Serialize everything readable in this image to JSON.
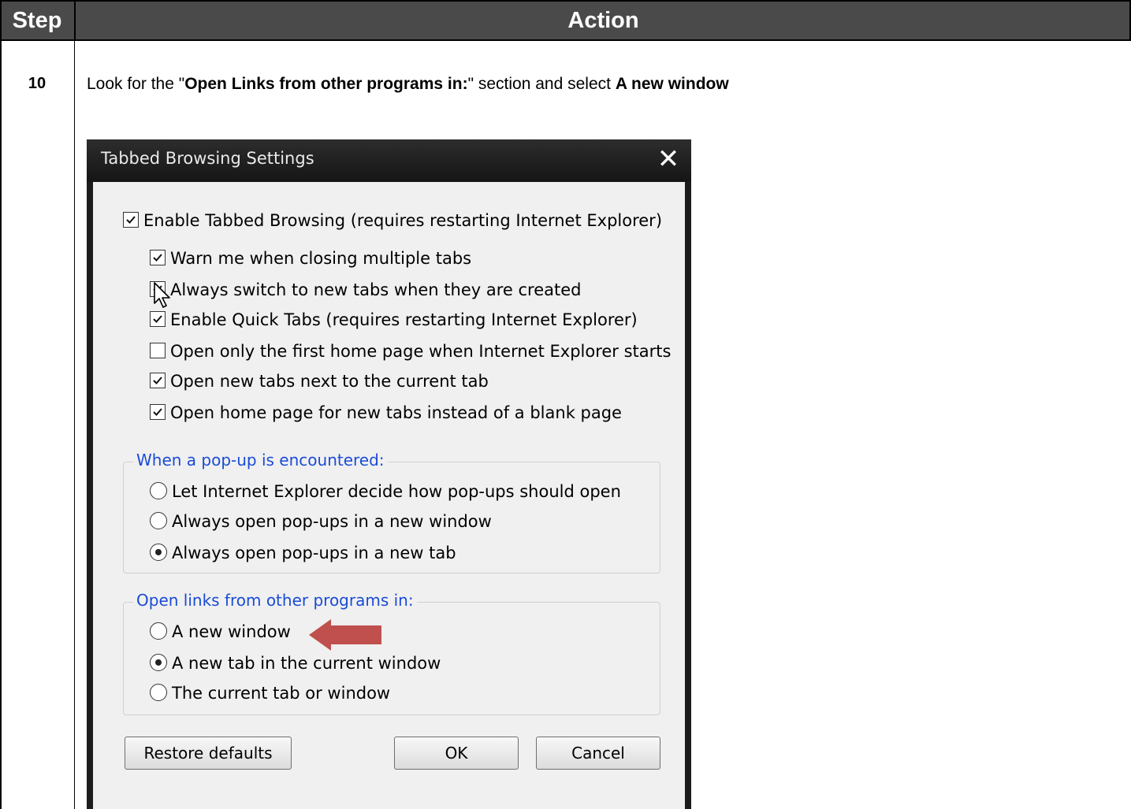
{
  "table": {
    "header_step": "Step",
    "header_action": "Action",
    "step_number": "10",
    "instruction": {
      "part1": "Look for the \"",
      "bold1": "Open Links from other programs in:",
      "part2": "\"  section and select ",
      "bold2": "A new window"
    }
  },
  "dialog": {
    "title": "Tabbed Browsing Settings",
    "close_glyph": "✕",
    "checkboxes": [
      {
        "label": "Enable Tabbed Browsing (requires restarting Internet Explorer)",
        "checked": true
      },
      {
        "label": "Warn me when closing multiple tabs",
        "checked": true
      },
      {
        "label": "Always switch to new tabs when they are created",
        "checked": true
      },
      {
        "label": "Enable Quick Tabs (requires restarting Internet Explorer)",
        "checked": true
      },
      {
        "label": "Open only the first home page when Internet Explorer starts",
        "checked": false
      },
      {
        "label": "Open new tabs next to the current tab",
        "checked": true
      },
      {
        "label": "Open home page for new tabs instead of a blank page",
        "checked": true
      }
    ],
    "popup_group": {
      "label": "When a pop-up is encountered:",
      "options": [
        {
          "label": "Let Internet Explorer decide how pop-ups should open",
          "selected": false
        },
        {
          "label": "Always open pop-ups in a new window",
          "selected": false
        },
        {
          "label": "Always open pop-ups in a new tab",
          "selected": true
        }
      ]
    },
    "links_group": {
      "label": "Open links from other programs in:",
      "options": [
        {
          "label": "A new window",
          "selected": false
        },
        {
          "label": "A new tab in the current window",
          "selected": true
        },
        {
          "label": "The current tab or window",
          "selected": false
        }
      ]
    },
    "buttons": {
      "restore": "Restore defaults",
      "ok": "OK",
      "cancel": "Cancel"
    }
  },
  "colors": {
    "header_bg": "#4a4a4a",
    "group_label": "#1a4bd6",
    "arrow": "#c0504d"
  }
}
